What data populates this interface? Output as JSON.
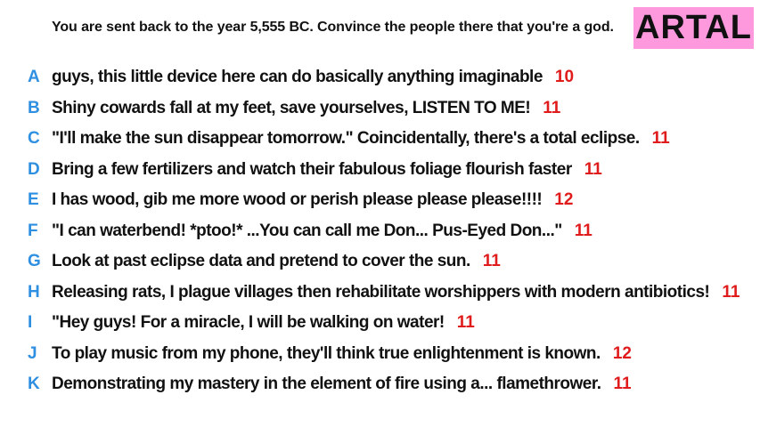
{
  "prompt": "You are sent back to the year 5,555 BC. Convince the people there that you're a god.",
  "badge": "ARTAL",
  "colors": {
    "letter": "#2f8fe0",
    "score": "#e01b1b",
    "badge_bg": "#ff99dd",
    "text": "#111111"
  },
  "answers": [
    {
      "letter": "A",
      "text": "guys, this little device here can do basically anything imaginable",
      "score": "10"
    },
    {
      "letter": "B",
      "text": "Shiny cowards fall at my feet, save yourselves, LISTEN TO ME!",
      "score": "11"
    },
    {
      "letter": "C",
      "text": "\"I'll make the sun disappear tomorrow.\" Coincidentally, there's a total eclipse.",
      "score": "11"
    },
    {
      "letter": "D",
      "text": "Bring a few fertilizers and watch their fabulous foliage flourish faster",
      "score": "11"
    },
    {
      "letter": "E",
      "text": "I has wood, gib me more wood or perish please please please!!!!",
      "score": "12"
    },
    {
      "letter": "F",
      "text": "\"I can waterbend! *ptoo!* ...You can call me Don... Pus-Eyed Don...\"",
      "score": "11"
    },
    {
      "letter": "G",
      "text": "Look at past eclipse data and pretend to cover the sun.",
      "score": "11"
    },
    {
      "letter": "H",
      "text": "Releasing rats, I plague villages then rehabilitate worshippers with modern antibiotics!",
      "score": "11"
    },
    {
      "letter": "I",
      "text": "\"Hey guys! For a miracle, I will be walking on water!",
      "score": "11"
    },
    {
      "letter": "J",
      "text": "To play music from my phone, they'll think true enlightenment is known.",
      "score": "12"
    },
    {
      "letter": "K",
      "text": "Demonstrating my mastery in the element of fire using a... flamethrower.",
      "score": "11"
    }
  ]
}
